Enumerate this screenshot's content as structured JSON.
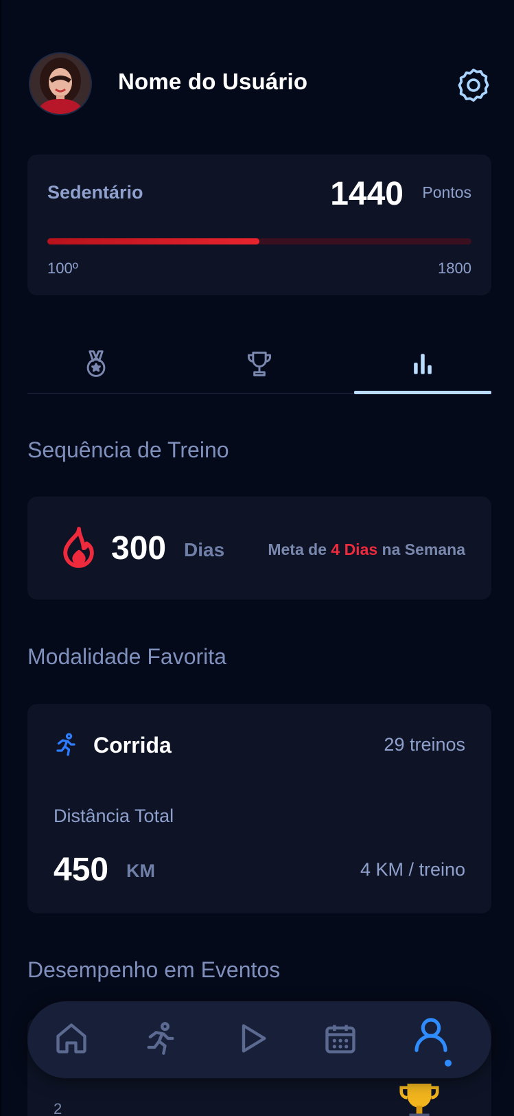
{
  "header": {
    "user_name": "Nome do Usuário",
    "avatar_icon": "avatar",
    "settings_icon": "gear-icon"
  },
  "level": {
    "name": "Sedentário",
    "points": "1440",
    "points_label": "Pontos",
    "range_min": "100º",
    "range_max": "1800",
    "progress": 0.5
  },
  "tabs": [
    {
      "icon": "medal-icon",
      "active": false
    },
    {
      "icon": "trophy-icon",
      "active": false
    },
    {
      "icon": "bar-chart-icon",
      "active": true
    }
  ],
  "streak": {
    "title": "Sequência de Treino",
    "value": "300",
    "unit": "Dias",
    "goal_prefix": "Meta de ",
    "goal_highlight": "4 Dias",
    "goal_suffix": " na Semana"
  },
  "favorite": {
    "title": "Modalidade Favorita",
    "name": "Corrida",
    "count": "29 treinos",
    "distance_label": "Distância Total",
    "distance_value": "450",
    "distance_unit": "KM",
    "per_training": "4 KM / treino"
  },
  "events": {
    "title": "Desempenho em Eventos",
    "peek_a": "·",
    "peek_b": "2"
  },
  "nav": [
    {
      "icon": "home-icon"
    },
    {
      "icon": "runner-icon"
    },
    {
      "icon": "play-icon"
    },
    {
      "icon": "calendar-icon"
    },
    {
      "icon": "profile-icon",
      "active": true
    }
  ],
  "colors": {
    "background": "#050a1a",
    "card": "#0e1426",
    "accent_red": "#e8242e",
    "accent_blue": "#2f8cff",
    "tab_active": "#b9dcff"
  }
}
